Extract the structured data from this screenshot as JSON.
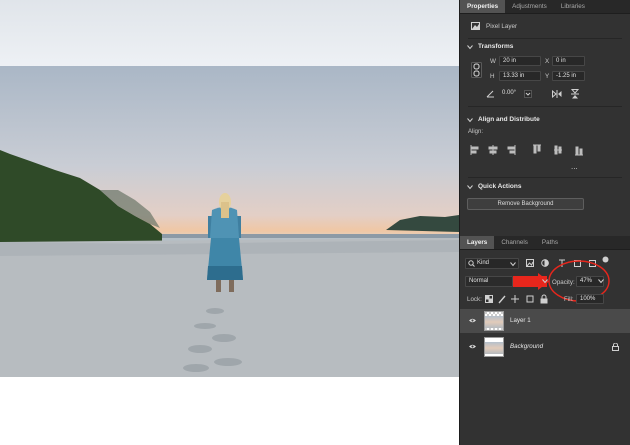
{
  "panel": {
    "tabs": [
      {
        "label": "Properties"
      },
      {
        "label": "Adjustments"
      },
      {
        "label": "Libraries"
      }
    ],
    "properties_type": "Pixel Layer",
    "transform": {
      "title": "Transforms",
      "w_label": "W",
      "w": "20 in",
      "h_label": "H",
      "h": "13.33 in",
      "x_label": "X",
      "x": "0 in",
      "y_label": "Y",
      "y": "-1.25 in",
      "angle": "0.00°"
    },
    "align": {
      "title": "Align and Distribute",
      "align_label": "Align:",
      "more": "..."
    },
    "quick_actions": {
      "title": "Quick Actions",
      "remove_bg_label": "Remove Background"
    },
    "layers_tabs": [
      {
        "label": "Layers"
      },
      {
        "label": "Channels"
      },
      {
        "label": "Paths"
      }
    ],
    "filter_kind": "Kind",
    "blend_mode": "Normal",
    "opacity_label": "Opacity:",
    "opacity_value": "47%",
    "opacity_fraction": 0.47,
    "lock_label": "Lock:",
    "fill_label": "Fill:",
    "fill_value": "100%",
    "layers": [
      {
        "name": "Layer 1",
        "selected": true
      },
      {
        "name": "Background",
        "selected": false,
        "locked": true
      }
    ]
  },
  "annotation": {
    "arrow_color": "#e8261c",
    "circle_color": "#e8261c"
  }
}
